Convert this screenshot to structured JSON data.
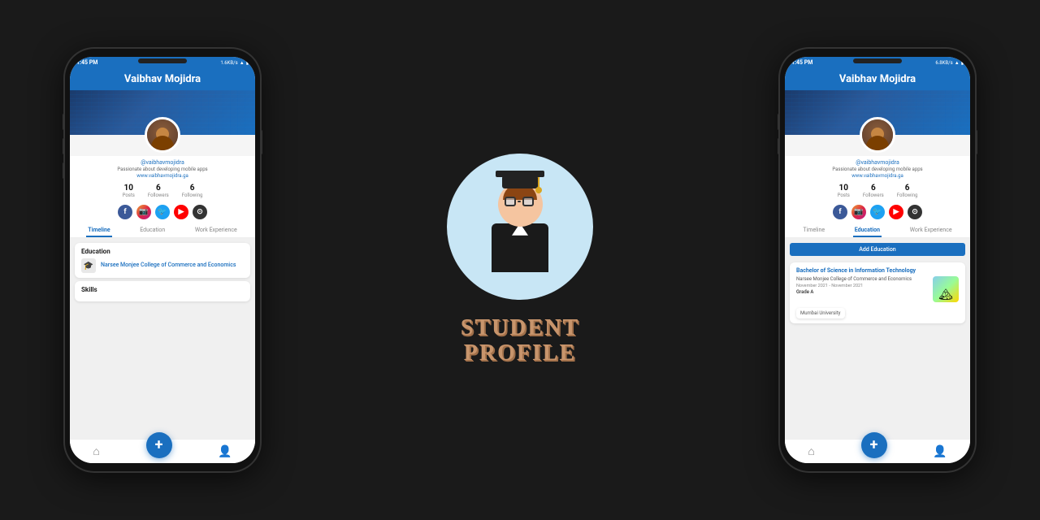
{
  "left_phone": {
    "status_bar": {
      "time": "1:45 PM",
      "network": "1.6KB/s",
      "battery": "100"
    },
    "header": {
      "title": "Vaibhav Mojidra"
    },
    "profile": {
      "username": "@vaibhavmojidra",
      "bio": "Passionate about developing mobile apps",
      "website": "www.vaibhavmojidra.ga"
    },
    "stats": [
      {
        "num": "10",
        "label": "Posts"
      },
      {
        "num": "6",
        "label": "Followers"
      },
      {
        "num": "6",
        "label": "Following"
      }
    ],
    "tabs": [
      "Timeline",
      "Education",
      "Work Experience"
    ],
    "active_tab": "Timeline",
    "education_card": {
      "title": "Education",
      "school": "Narsee Monjee College of Commerce and Economics"
    },
    "skills_card": {
      "title": "Skills"
    }
  },
  "center": {
    "title_line1": "STUDENT",
    "title_line2": "PROFILE"
  },
  "right_phone": {
    "status_bar": {
      "time": "1:45 PM",
      "network": "6.8KB/s",
      "battery": "100"
    },
    "header": {
      "title": "Vaibhav Mojidra"
    },
    "profile": {
      "username": "@vaibhavmojidra",
      "bio": "Passionate about developing mobile apps",
      "website": "www.vaibhavmojidra.ga"
    },
    "stats": [
      {
        "num": "10",
        "label": "Posts"
      },
      {
        "num": "6",
        "label": "Followers"
      },
      {
        "num": "6",
        "label": "Following"
      }
    ],
    "tabs": [
      "Timeline",
      "Education",
      "Work Experience"
    ],
    "active_tab": "Education",
    "add_button": "Add Education",
    "education_item": {
      "degree": "Bachelor of Science in Information Technology",
      "school": "Narsee Monjee College of Commerce and Economics",
      "dates": "November 2021 - November 2021",
      "grade": "Grade A"
    },
    "mumbai_badge": "Mumbai University"
  }
}
